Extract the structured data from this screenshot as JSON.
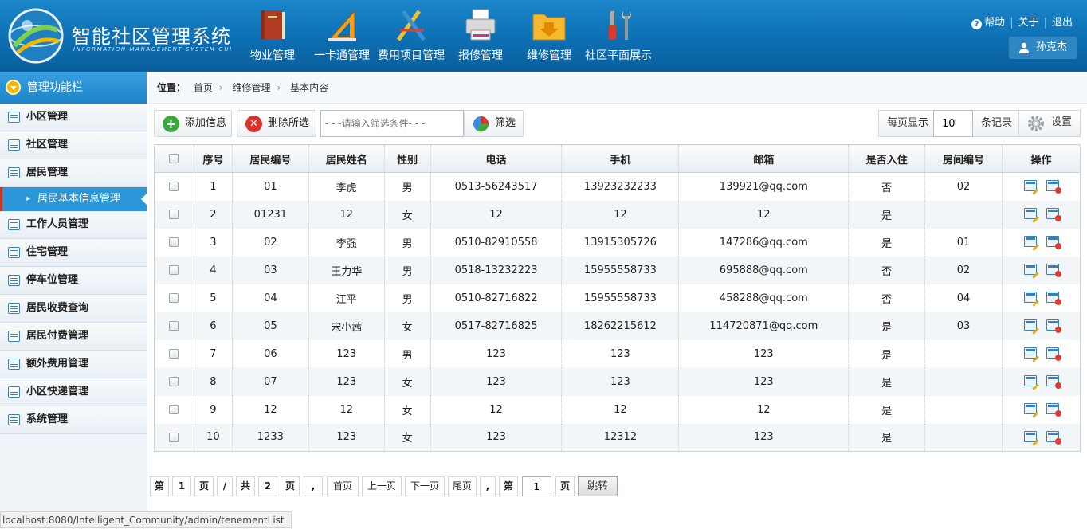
{
  "header": {
    "app_title": "智能社区管理系统",
    "app_subtitle": "INFORMATION MANAGEMENT SYSTEM GUI",
    "nav": [
      {
        "label": "物业管理",
        "icon": "book-icon"
      },
      {
        "label": "一卡通管理",
        "icon": "ruler-triangle-icon"
      },
      {
        "label": "费用项目管理",
        "icon": "drafting-tools-icon"
      },
      {
        "label": "报修管理",
        "icon": "printer-icon"
      },
      {
        "label": "维修管理",
        "icon": "folder-download-icon"
      },
      {
        "label": "社区平面展示",
        "icon": "tools-icon"
      }
    ],
    "help_label": "帮助",
    "about_label": "关于",
    "logout_label": "退出",
    "user_name": "孙克杰"
  },
  "sidebar": {
    "title": "管理功能栏",
    "items": [
      {
        "label": "小区管理"
      },
      {
        "label": "社区管理"
      },
      {
        "label": "居民管理"
      },
      {
        "label": "居民基本信息管理",
        "sub": true,
        "active": true
      },
      {
        "label": "工作人员管理"
      },
      {
        "label": "住宅管理"
      },
      {
        "label": "停车位管理"
      },
      {
        "label": "居民收费查询"
      },
      {
        "label": "居民付费管理"
      },
      {
        "label": "额外费用管理"
      },
      {
        "label": "小区快递管理"
      },
      {
        "label": "系统管理"
      }
    ]
  },
  "breadcrumb": {
    "label": "位置：",
    "items": [
      "首页",
      "维修管理",
      "基本内容"
    ]
  },
  "toolbar": {
    "add_label": "添加信息",
    "delete_label": "删除所选",
    "filter_placeholder": "- - -请输入筛选条件- - -",
    "filter_label": "筛选",
    "perpage_label": "每页显示",
    "perpage_value": "10",
    "perpage_suffix": "条记录",
    "settings_label": "设置"
  },
  "table": {
    "columns": [
      "序号",
      "居民编号",
      "居民姓名",
      "性别",
      "电话",
      "手机",
      "邮箱",
      "是否入住",
      "房间编号",
      "操作"
    ],
    "rows": [
      [
        "1",
        "01",
        "李虎",
        "男",
        "0513-56243517",
        "13923232233",
        "139921@qq.com",
        "否",
        "02"
      ],
      [
        "2",
        "01231",
        "12",
        "女",
        "12",
        "12",
        "12",
        "是",
        ""
      ],
      [
        "3",
        "02",
        "李强",
        "男",
        "0510-82910558",
        "13915305726",
        "147286@qq.com",
        "是",
        "01"
      ],
      [
        "4",
        "03",
        "王力华",
        "男",
        "0518-13232223",
        "15955558733",
        "695888@qq.com",
        "否",
        "02"
      ],
      [
        "5",
        "04",
        "江平",
        "男",
        "0510-82716822",
        "15955558733",
        "458288@qq.com",
        "否",
        "04"
      ],
      [
        "6",
        "05",
        "宋小茜",
        "女",
        "0517-82716825",
        "18262215612",
        "114720871@qq.com",
        "是",
        "03"
      ],
      [
        "7",
        "06",
        "123",
        "男",
        "123",
        "123",
        "123",
        "是",
        ""
      ],
      [
        "8",
        "07",
        "123",
        "女",
        "123",
        "123",
        "123",
        "是",
        ""
      ],
      [
        "9",
        "12",
        "12",
        "女",
        "12",
        "12",
        "12",
        "是",
        ""
      ],
      [
        "10",
        "1233",
        "123",
        "女",
        "123",
        "12312",
        "123",
        "是",
        ""
      ]
    ]
  },
  "pager": {
    "di": "第",
    "current_page": "1",
    "ye": "页",
    "slash": "/",
    "gong": "共",
    "total_pages": "2",
    "comma": ",",
    "first": "首页",
    "prev": "上一页",
    "next": "下一页",
    "last": "尾页",
    "jump_value": "1",
    "jump_label": "跳转"
  },
  "status_bar": "localhost:8080/Intelligent_Community/admin/tenementList",
  "colors": {
    "header_blue": "#0d6fb3",
    "active_blue": "#2b97d9",
    "add_green": "#3aa83a",
    "delete_red": "#d9342b"
  }
}
